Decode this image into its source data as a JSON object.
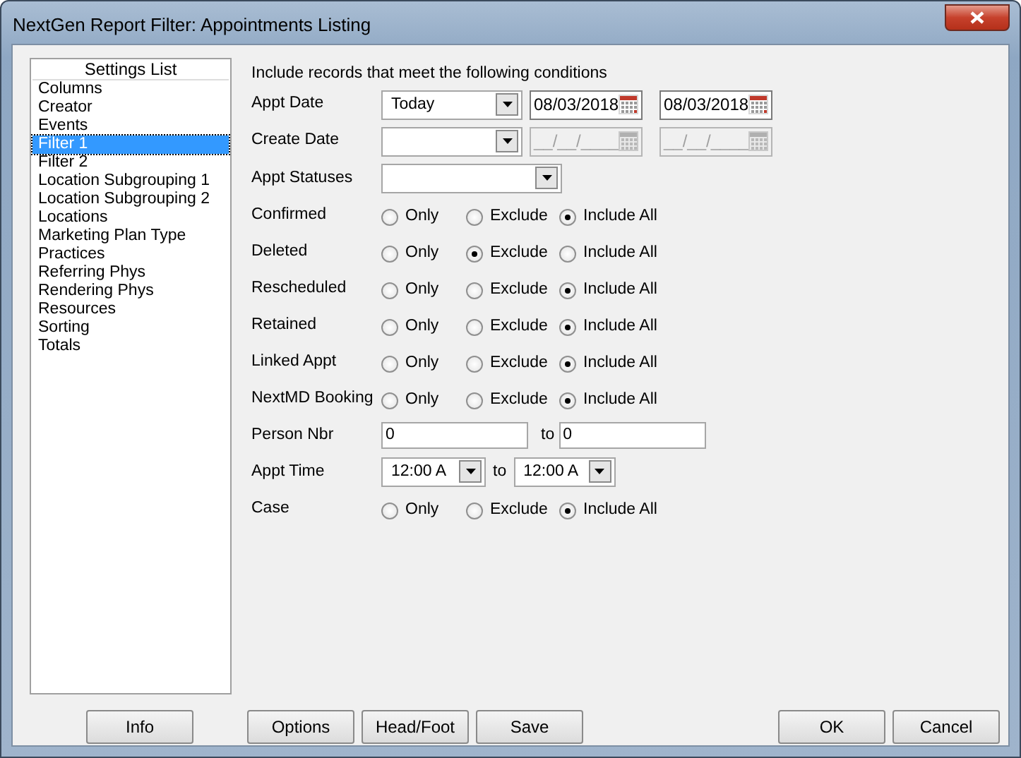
{
  "window": {
    "title": "NextGen Report Filter: Appointments Listing"
  },
  "settings_list": {
    "title": "Settings List",
    "items": [
      {
        "label": "Columns",
        "selected": false
      },
      {
        "label": "Creator",
        "selected": false
      },
      {
        "label": "Events",
        "selected": false
      },
      {
        "label": "Filter 1",
        "selected": true
      },
      {
        "label": "Filter 2",
        "selected": false
      },
      {
        "label": "Location Subgrouping 1",
        "selected": false
      },
      {
        "label": "Location Subgrouping 2",
        "selected": false
      },
      {
        "label": "Locations",
        "selected": false
      },
      {
        "label": "Marketing Plan Type",
        "selected": false
      },
      {
        "label": "Practices",
        "selected": false
      },
      {
        "label": "Referring Phys",
        "selected": false
      },
      {
        "label": "Rendering Phys",
        "selected": false
      },
      {
        "label": "Resources",
        "selected": false
      },
      {
        "label": "Sorting",
        "selected": false
      },
      {
        "label": "Totals",
        "selected": false
      }
    ]
  },
  "heading": "Include records that meet the following conditions",
  "filters": [
    {
      "kind": "dates",
      "label": "Appt Date",
      "dropdown": "Today",
      "from": {
        "value": "08/03/2018",
        "disabled": false
      },
      "to": {
        "value": "08/03/2018",
        "disabled": false
      }
    },
    {
      "kind": "dates",
      "label": "Create Date",
      "from": {
        "value": "__/__/____",
        "disabled": true
      },
      "to": {
        "value": "__/__/____",
        "disabled": true
      }
    },
    {
      "kind": "dropdown",
      "label": "Appt Statuses"
    },
    {
      "kind": "radio",
      "label": "Confirmed",
      "options": [
        {
          "label": "Only",
          "selected": false
        },
        {
          "label": "Exclude",
          "selected": false
        },
        {
          "label": "Include All",
          "selected": true
        }
      ]
    },
    {
      "kind": "radio",
      "label": "Deleted",
      "options": [
        {
          "label": "Only",
          "selected": false
        },
        {
          "label": "Exclude",
          "selected": true
        },
        {
          "label": "Include All",
          "selected": false
        }
      ]
    },
    {
      "kind": "radio",
      "label": "Rescheduled",
      "options": [
        {
          "label": "Only",
          "selected": false
        },
        {
          "label": "Exclude",
          "selected": false
        },
        {
          "label": "Include All",
          "selected": true
        }
      ]
    },
    {
      "kind": "radio",
      "label": "Retained",
      "options": [
        {
          "label": "Only",
          "selected": false
        },
        {
          "label": "Exclude",
          "selected": false
        },
        {
          "label": "Include All",
          "selected": true
        }
      ]
    },
    {
      "kind": "radio",
      "label": "Linked Appt",
      "options": [
        {
          "label": "Only",
          "selected": false
        },
        {
          "label": "Exclude",
          "selected": false
        },
        {
          "label": "Include All",
          "selected": true
        }
      ]
    },
    {
      "kind": "radio",
      "label": "NextMD Booking",
      "options": [
        {
          "label": "Only",
          "selected": false
        },
        {
          "label": "Exclude",
          "selected": false
        },
        {
          "label": "Include All",
          "selected": true
        }
      ]
    },
    {
      "kind": "text_range",
      "label": "Person Nbr",
      "from": "0",
      "to_label": "to",
      "to": "0"
    },
    {
      "kind": "time_range",
      "label": "Appt Time",
      "from": "12:00 A",
      "to_label": "to",
      "to": "12:00 A"
    },
    {
      "kind": "radio",
      "label": "Case",
      "options": [
        {
          "label": "Only",
          "selected": false
        },
        {
          "label": "Exclude",
          "selected": false
        },
        {
          "label": "Include All",
          "selected": true
        }
      ]
    }
  ],
  "left_buttons": [
    "Info"
  ],
  "middle_buttons": [
    "Options",
    "Head/Foot",
    "Save"
  ],
  "right_buttons": [
    "OK",
    "Cancel"
  ]
}
